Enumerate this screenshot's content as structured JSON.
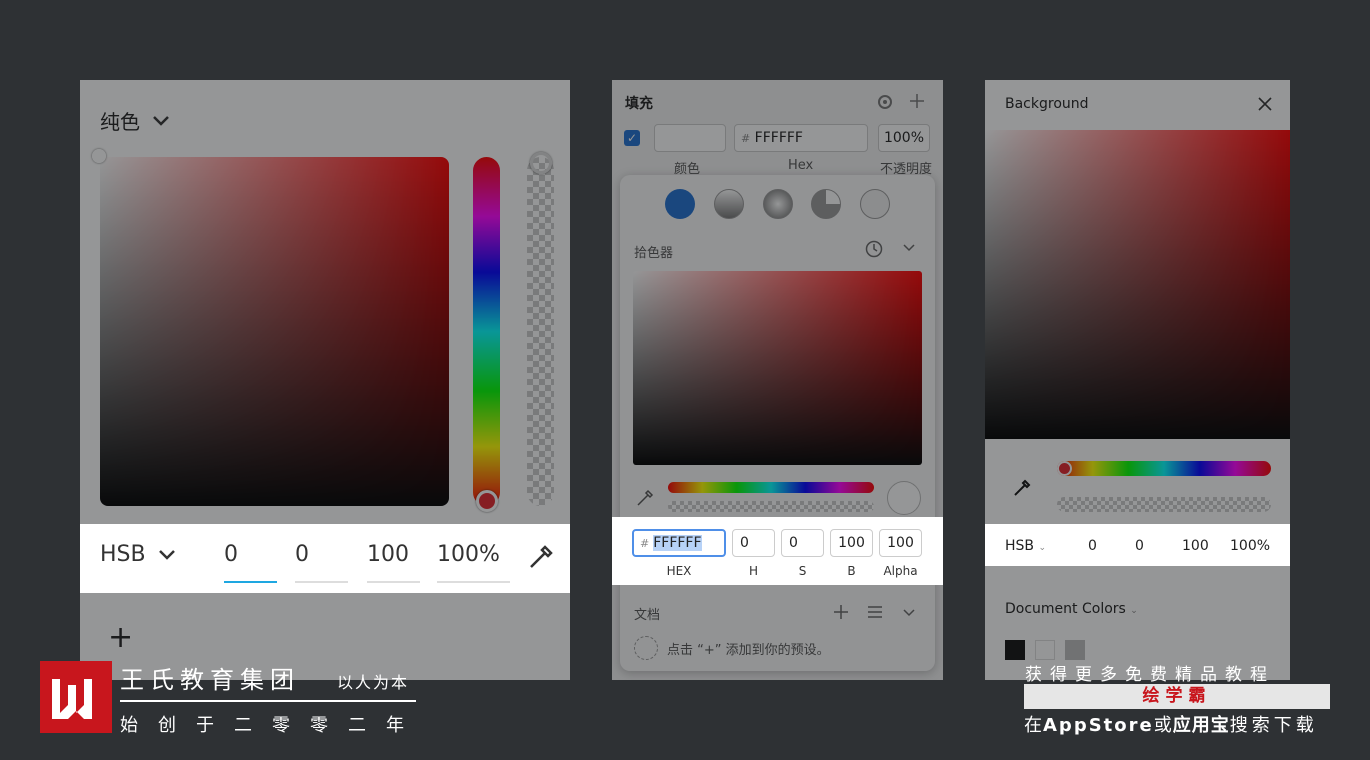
{
  "colors": {
    "background": "#2e3134",
    "brand_red": "#c8161d",
    "accent_blue": "#1f6fd1"
  },
  "panel1": {
    "mode_label": "纯色",
    "format_label": "HSB",
    "values": [
      "0",
      "0",
      "100",
      "100%"
    ],
    "icons": [
      "chevron-down-icon",
      "eyedropper-icon",
      "plus-icon"
    ]
  },
  "panel2": {
    "title": "填充",
    "hex_prefix": "#",
    "hex_value": "FFFFFF",
    "opacity": "100%",
    "row_labels": [
      "颜色",
      "Hex",
      "不透明度"
    ],
    "picker_label": "拾色器",
    "inputs": {
      "hex": "FFFFFF",
      "h": "0",
      "s": "0",
      "b": "100",
      "alpha": "100"
    },
    "input_labels": [
      "HEX",
      "H",
      "S",
      "B",
      "Alpha"
    ],
    "doc_label": "文档",
    "presets_hint": "点击 “+” 添加到你的预设。"
  },
  "panel3": {
    "title": "Background",
    "format_label": "HSB",
    "values": [
      "0",
      "0",
      "100",
      "100%"
    ],
    "doc_colors_label": "Document Colors"
  },
  "branding": {
    "company": "王氏教育集团",
    "motto": "以人为本",
    "founded": "始创于二零零二年",
    "promo_line1": "获得更多免费精品教程",
    "app_name": "绘学霸",
    "promo_line2_a": "在",
    "promo_line2_b": "AppStore",
    "promo_line2_c": "或",
    "promo_line2_d": "应用宝",
    "promo_line2_e": "搜索下载"
  }
}
